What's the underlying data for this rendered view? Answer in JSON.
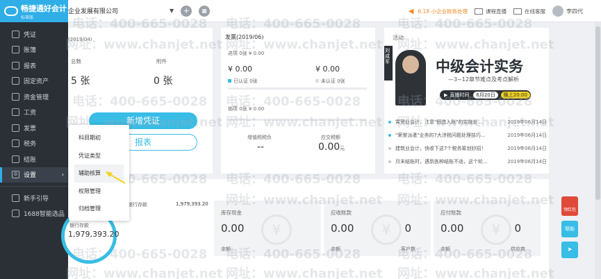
{
  "app": {
    "logo_title": "畅捷通好会计",
    "logo_sub": "标准版"
  },
  "sidebar": {
    "items": [
      {
        "label": "凭证",
        "icon": "voucher-icon"
      },
      {
        "label": "账簿",
        "icon": "ledger-icon"
      },
      {
        "label": "报表",
        "icon": "report-icon"
      },
      {
        "label": "固定资产",
        "icon": "asset-icon"
      },
      {
        "label": "资金管理",
        "icon": "fund-icon"
      },
      {
        "label": "工资",
        "icon": "salary-icon"
      },
      {
        "label": "发票",
        "icon": "invoice-icon"
      },
      {
        "label": "税务",
        "icon": "tax-icon"
      },
      {
        "label": "结账",
        "icon": "closing-icon"
      },
      {
        "label": "设置",
        "icon": "settings-icon",
        "active": true
      }
    ],
    "extra": [
      {
        "label": "新手引导",
        "icon": "guide-icon"
      },
      {
        "label": "1688智能选品",
        "icon": "shop-icon"
      }
    ]
  },
  "header": {
    "company": "企业发展有限公司",
    "notice": "6.18 小企业账务处理",
    "live_course": "课程直播",
    "online_service": "在线客服",
    "user_name": "李四代"
  },
  "voucher_card": {
    "period": "(2019/04)",
    "total_label": "总数",
    "total_value": "5 张",
    "attach_label": "附件",
    "attach_value": "0 张",
    "new_voucher_btn": "新增凭证",
    "report_btn": "报表"
  },
  "invoice_card": {
    "title": "发票(2019/06)",
    "input_line": "进项  0张  ¥ 0.00",
    "amount_left": "¥ 0.00",
    "amount_right": "¥ 0.00",
    "certified": "已认证  0张",
    "uncertified": "未认证  0张",
    "output_line": "销项  0张  ¥ 0.00",
    "vat_label": "增值税税负",
    "vat_value": "--",
    "tax_due_label": "应交税额",
    "tax_due_value": "0.00",
    "tax_due_unit": "元"
  },
  "activity_card": {
    "title": "活动",
    "banner_title": "中级会计实务",
    "banner_sub": "—3~12章节难点及考点解析",
    "banner_live": "直播时间",
    "banner_date": "6月20日",
    "banner_time": "晚上20:00",
    "banner_name": "刘成军",
    "items": [
      {
        "text": "霄贺业会计，注意\"假造入账\"的实施处...",
        "date": "2019年06月14日"
      },
      {
        "text": "\"荣誉派遣\"业务的7大涉税问题处理技巧...",
        "date": "2019年06月14日"
      },
      {
        "text": "建筑业会计，快收下这7个税务筹划妙招！",
        "date": "2019年06月14日"
      },
      {
        "text": "月末结账时，遇到各种结账不适，这个轮...",
        "date": "2019年06月14日"
      }
    ]
  },
  "bottom": {
    "bank_label_top": "银行存款",
    "bank_value_top": "1,979,393.20",
    "bank_label": "银行存款",
    "bank_value": "1,979,393.20",
    "stats": [
      {
        "label": "库存现金",
        "value": "0.00",
        "sub": "余额",
        "count": "",
        "count_label": ""
      },
      {
        "label": "应收账款",
        "value": "0.00",
        "sub": "余额",
        "count": "0",
        "count_label": "客户数"
      },
      {
        "label": "应付账款",
        "value": "0.00",
        "sub": "余额",
        "count": "0",
        "count_label": "供应商"
      }
    ]
  },
  "dropdown": {
    "items": [
      "科目期初",
      "凭证类型",
      "辅助核算",
      "权限管理",
      "归档管理"
    ],
    "highlighted": "辅助核算"
  },
  "floats": {
    "red": "领红包",
    "blue": "帮助"
  },
  "watermark": {
    "phone": "电话：400-665-0028",
    "site": "网址：www.chanjet.net"
  },
  "colors": {
    "accent": "#37bde6",
    "sidebar_bg": "#2b3036",
    "notice": "#f08a24",
    "highlight_arrow": "#f3d21e"
  }
}
